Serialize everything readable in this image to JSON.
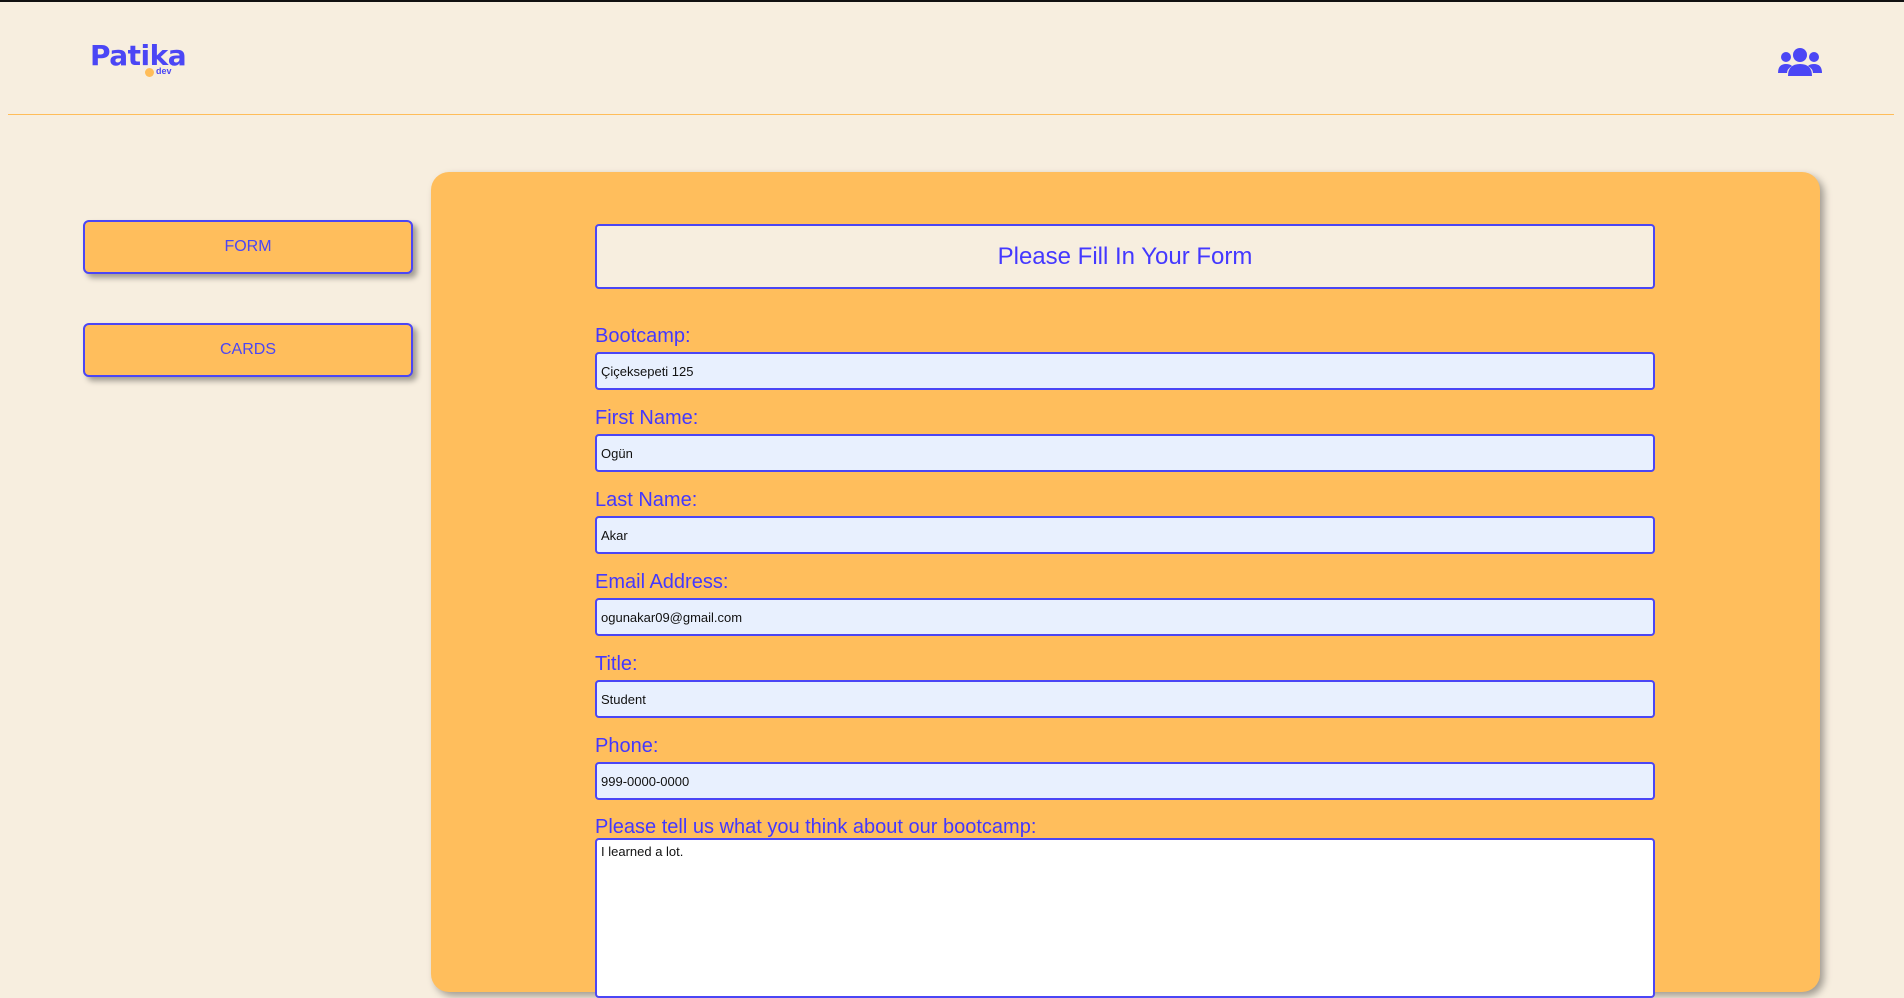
{
  "header": {
    "logo_text": "Patika",
    "logo_sub": "dev",
    "users_icon": "users-icon"
  },
  "sidebar": {
    "items": [
      {
        "label": "FORM"
      },
      {
        "label": "CARDS"
      }
    ]
  },
  "form": {
    "title": "Please Fill In Your Form",
    "fields": [
      {
        "label": "Bootcamp:",
        "value": "Çiçeksepeti 125"
      },
      {
        "label": "First Name:",
        "value": "Ogün"
      },
      {
        "label": "Last Name:",
        "value": "Akar"
      },
      {
        "label": "Email Address:",
        "value": "ogunakar09@gmail.com"
      },
      {
        "label": "Title:",
        "value": "Student"
      },
      {
        "label": "Phone:",
        "value": "999-0000-0000"
      }
    ],
    "feedback_label": "Please tell us what you think about our bootcamp:",
    "feedback_value": "I learned a lot."
  },
  "colors": {
    "background": "#f7eedf",
    "accent": "#4b46f5",
    "panel": "#ffbe5c",
    "input_bg": "#e8f0fe"
  }
}
